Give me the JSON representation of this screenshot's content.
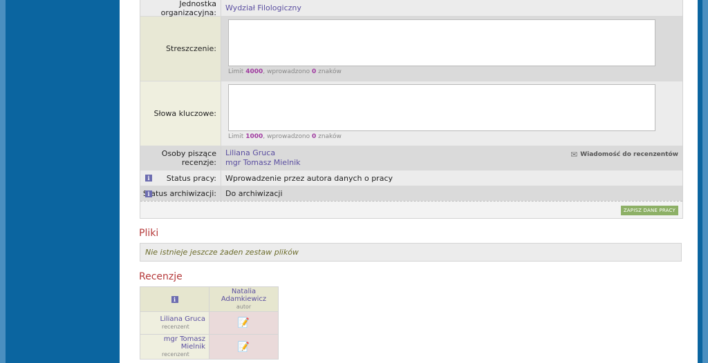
{
  "form": {
    "rows": {
      "org_unit": {
        "label": "Jednostka organizacyjna:",
        "value": "Wydział Filologiczny"
      },
      "summary": {
        "label": "Streszczenie:",
        "limit_prefix": "Limit",
        "limit": "4000",
        "entered_prefix": ", wprowadzono",
        "entered": "0",
        "suffix": "znaków"
      },
      "keywords": {
        "label": "Słowa kluczowe:",
        "limit_prefix": "Limit",
        "limit": "1000",
        "entered_prefix": ", wprowadzono",
        "entered": "0",
        "suffix": "znaków"
      },
      "reviewers": {
        "label": "Osoby piszące recenzje:",
        "names": [
          "Liliana Gruca",
          "mgr Tomasz Mielnik"
        ],
        "message_link": "Wiadomość do recenzentów"
      },
      "work_status": {
        "label": "Status pracy:",
        "value": "Wprowadzenie przez autora danych o pracy",
        "icon": "info-icon"
      },
      "archive_status": {
        "label": "Status archiwizacji:",
        "value": "Do archiwizacji",
        "icon": "info-icon"
      }
    },
    "save_button": "ZAPISZ DANE PRACY"
  },
  "files": {
    "title": "Pliki",
    "empty_text": "Nie istnieje jeszcze żaden zestaw plików"
  },
  "reviews": {
    "title": "Recenzje",
    "author": {
      "name": "Natalia Adamkiewicz",
      "role": "autor"
    },
    "reviewers": [
      {
        "name": "Liliana Gruca",
        "role": "recenzent"
      },
      {
        "name": "mgr Tomasz Mielnik",
        "role": "recenzent"
      }
    ]
  },
  "colors": {
    "page_bg": "#0b65a0",
    "accent_heading": "#b5393a",
    "link": "#5a4ea0",
    "save_button": "#8db066"
  }
}
